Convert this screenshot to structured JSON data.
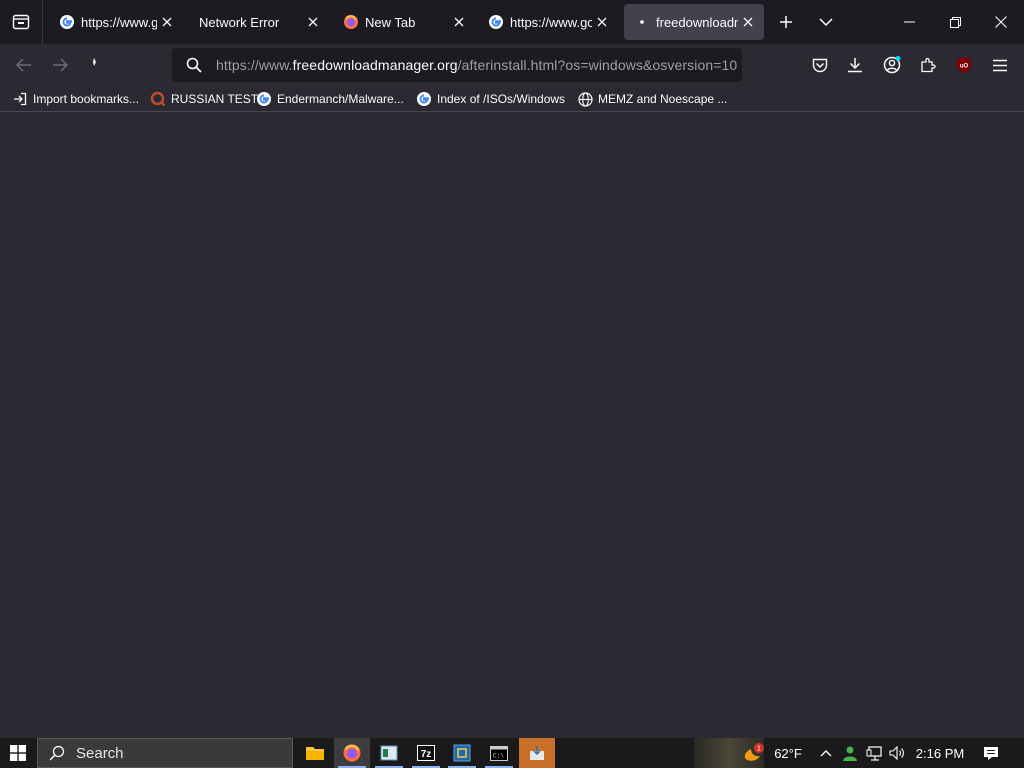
{
  "tabs": [
    {
      "title": "https://www.go",
      "favicon": "google-icon",
      "active": false
    },
    {
      "title": "Network Error",
      "favicon": "",
      "active": false
    },
    {
      "title": "New Tab",
      "favicon": "firefox-icon",
      "active": false
    },
    {
      "title": "https://www.go",
      "favicon": "google-icon",
      "active": false
    },
    {
      "title": "freedownloadm",
      "favicon": "loading-icon",
      "active": true
    }
  ],
  "url": {
    "prefix": "https://www.",
    "domain": "freedownloadmanager.org",
    "path": "/afterinstall.html?os=windows&osversion=10"
  },
  "bookmarks": [
    {
      "label": "Import bookmarks...",
      "icon": "import-icon"
    },
    {
      "label": "RUSSIAN TEST",
      "icon": "search-q-icon"
    },
    {
      "label": "Endermanch/Malware...",
      "icon": "google-icon"
    },
    {
      "label": "Index of /ISOs/Windows",
      "icon": "google-icon"
    },
    {
      "label": "MEMZ and Noescape ...",
      "icon": "globe-icon"
    }
  ],
  "taskbar": {
    "search_placeholder": "Search",
    "apps": [
      "file-explorer-icon",
      "firefox-icon",
      "app-window-icon",
      "7zip-icon",
      "virtualbox-icon",
      "cmd-icon",
      "installer-icon"
    ],
    "weather_temp": "62°F",
    "weather_badge": "1",
    "time": "2:16 PM"
  },
  "colors": {
    "content_bg": "#2b2a33",
    "tabstrip_bg": "#1c1b22",
    "active_tab": "#42414d",
    "taskbar_bg": "#1a1a1a",
    "highlight_app": "#c8702a"
  }
}
